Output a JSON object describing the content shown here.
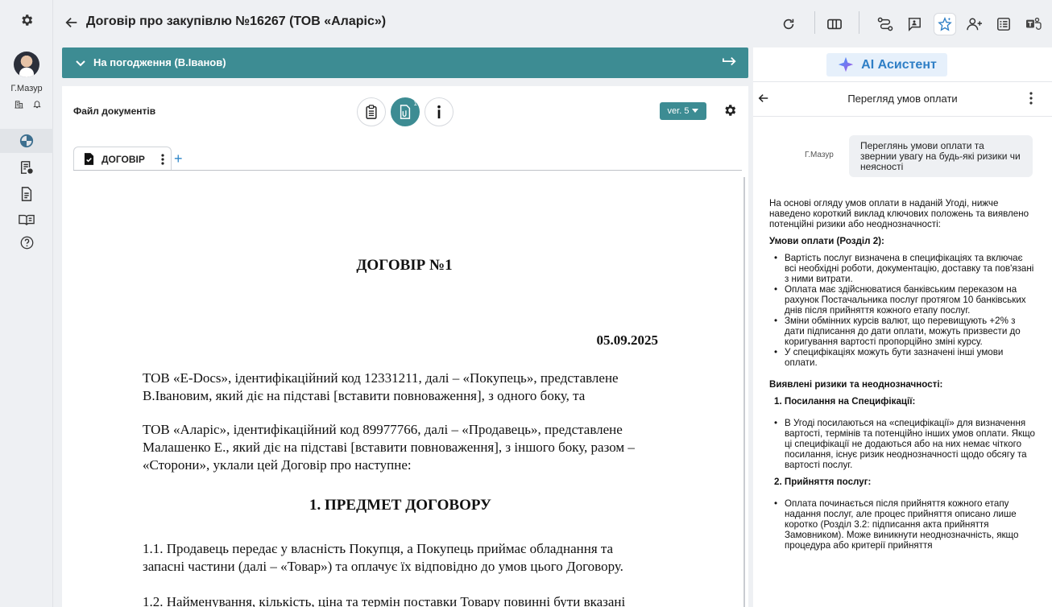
{
  "rail": {
    "user_name": "Г.Мазур"
  },
  "header": {
    "title": "Договір про закупівлю №16267 (ТОВ «Аларіс»)"
  },
  "approval": {
    "label": "На погодження (В.Іванов)"
  },
  "doc_panel": {
    "file_label": "Файл документів",
    "badge_count": "1",
    "version_label": "ver. 5",
    "tab_label": "ДОГОВІР"
  },
  "document": {
    "heading": "ДОГОВІР №1",
    "date": "05.09.2025",
    "para1": "ТОВ «E-Docs», ідентифікаційний код 12331211, далі – «Покупець», представлене В.Івановим, який діє на підставі [вставити повноваження], з одного боку, та",
    "para2": "ТОВ «Аларіс», ідентифікаційний код 89977766, далі – «Продавець», представлене Малашенко Е., який діє на підставі [вставити повноваження], з іншого боку, разом – «Сторони», уклали цей Договір про наступне:",
    "section1": "1. ПРЕДМЕТ ДОГОВОРУ",
    "clause11": "1.1. Продавець передає у власність Покупця, а Покупець приймає обладнання та запасні частини (далі – «Товар») та оплачує їх відповідно до умов цього Договору.",
    "clause12": "1.2. Найменування, кількість, ціна та термін поставки Товару повинні бути вказані"
  },
  "ai": {
    "title": "AI Асистент",
    "subtitle": "Перегляд умов оплати",
    "user_name": "Г.Мазур",
    "user_message": "Переглянь умови оплати та звернии увагу на будь-які ризики чи неясності",
    "intro": "На основі огляду умов оплати в наданій Угоді, нижче наведено короткий виклад ключових положень та виявлено потенційні ризики або неоднозначності:",
    "terms_heading": "Умови оплати (Розділ 2):",
    "terms": [
      "Вартість послуг визначена в специфікаціях та включає всі необхідні роботи, документацію, доставку та пов'язані з ними витрати.",
      "Оплата має здійснюватися банківським переказом на рахунок Постачальника послуг протягом 10 банківських днів після прийняття кожного етапу послуг.",
      "Зміни обмінних курсів валют, що перевищують +2% з дати підписання до дати оплати, можуть призвести до коригування вартості пропорційно зміні курсу.",
      "У специфікаціях можуть бути зазначені інші умови оплати."
    ],
    "risks_heading": "Виявлені ризики та неоднозначності:",
    "risk1_title": "1. Посилання на Специфікації:",
    "risk1_items": [
      "В Угоді посилаються на «специфікації» для визначення вартості, термінів та потенційно інших умов оплати. Якщо ці специфікації не додаються або на них немає чіткого посилання, існує ризик неоднозначності щодо обсягу та вартості послуг."
    ],
    "risk2_title": "2. Прийняття послуг:",
    "risk2_items": [
      "Оплата починається після прийняття кожного етапу надання послуг, але процес прийняття описано лише коротко (Розділ 3.2: підписання акта прийняття Замовником). Може виникнути неоднозначність, якщо процедура або критерії прийняття"
    ]
  }
}
